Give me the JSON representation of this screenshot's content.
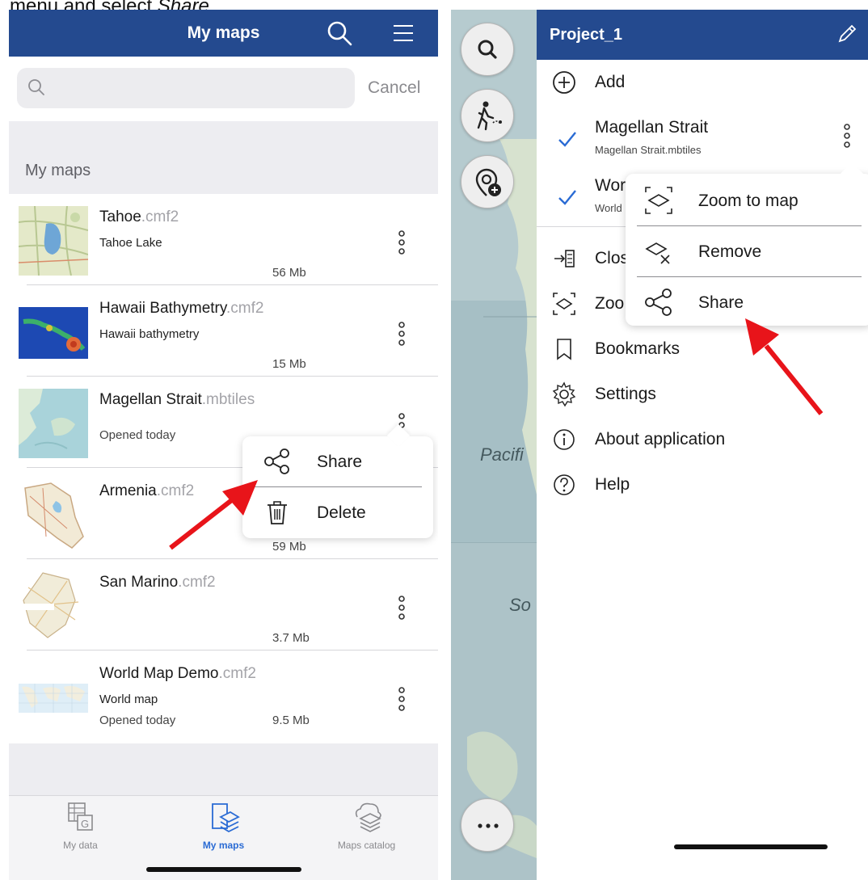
{
  "caption": {
    "prefix": "menu and select ",
    "emphasis": "Share",
    "suffix": "."
  },
  "left": {
    "header": {
      "title": "My maps",
      "search_icon": "search-icon",
      "menu_icon": "hamburger-menu-icon"
    },
    "search": {
      "placeholder": "",
      "cancel_label": "Cancel"
    },
    "section_title": "My maps",
    "maps": [
      {
        "name": "Tahoe",
        "ext": ".cmf2",
        "description": "Tahoe Lake",
        "opened": "",
        "size": "56 Mb"
      },
      {
        "name": "Hawaii Bathymetry",
        "ext": ".cmf2",
        "description": "Hawaii bathymetry",
        "opened": "",
        "size": "15 Mb"
      },
      {
        "name": "Magellan Strait",
        "ext": ".mbtiles",
        "description": "",
        "opened": "Opened today",
        "size": ""
      },
      {
        "name": "Armenia",
        "ext": ".cmf2",
        "description": "",
        "opened": "",
        "size": "59 Mb"
      },
      {
        "name": "San Marino",
        "ext": ".cmf2",
        "description": "",
        "opened": "",
        "size": "3.7 Mb"
      },
      {
        "name": "World Map Demo",
        "ext": ".cmf2",
        "description": "World map",
        "opened": "Opened today",
        "size": "9.5 Mb"
      }
    ],
    "context_menu": {
      "share_label": "Share",
      "delete_label": "Delete"
    },
    "tabs": [
      {
        "label": "My data",
        "active": false
      },
      {
        "label": "My maps",
        "active": true
      },
      {
        "label": "Maps catalog",
        "active": false
      }
    ]
  },
  "right": {
    "map_labels": {
      "ocean1": "Pacifi",
      "ocean2": "So"
    },
    "header": {
      "title": "Project_1",
      "edit_icon": "pencil-icon"
    },
    "add_label": "Add",
    "maps": [
      {
        "name": "Magellan Strait",
        "file": "Magellan Strait.mbtiles",
        "checked": true
      },
      {
        "name": "Wor",
        "file": "World",
        "checked": true
      }
    ],
    "menu": [
      {
        "label": "Clos",
        "icon": "close-project-icon"
      },
      {
        "label": "Zoo",
        "icon": "zoom-to-map-icon"
      },
      {
        "label": "Bookmarks",
        "icon": "bookmark-icon"
      },
      {
        "label": "Settings",
        "icon": "gear-icon"
      },
      {
        "label": "About application",
        "icon": "info-icon"
      },
      {
        "label": "Help",
        "icon": "help-icon"
      }
    ],
    "popup": {
      "zoom_label": "Zoom to map",
      "remove_label": "Remove",
      "share_label": "Share"
    }
  },
  "colors": {
    "header": "#244a8f",
    "active_tab": "#2a6bd4",
    "arrow": "#e8141a",
    "check": "#2a6bd4"
  }
}
